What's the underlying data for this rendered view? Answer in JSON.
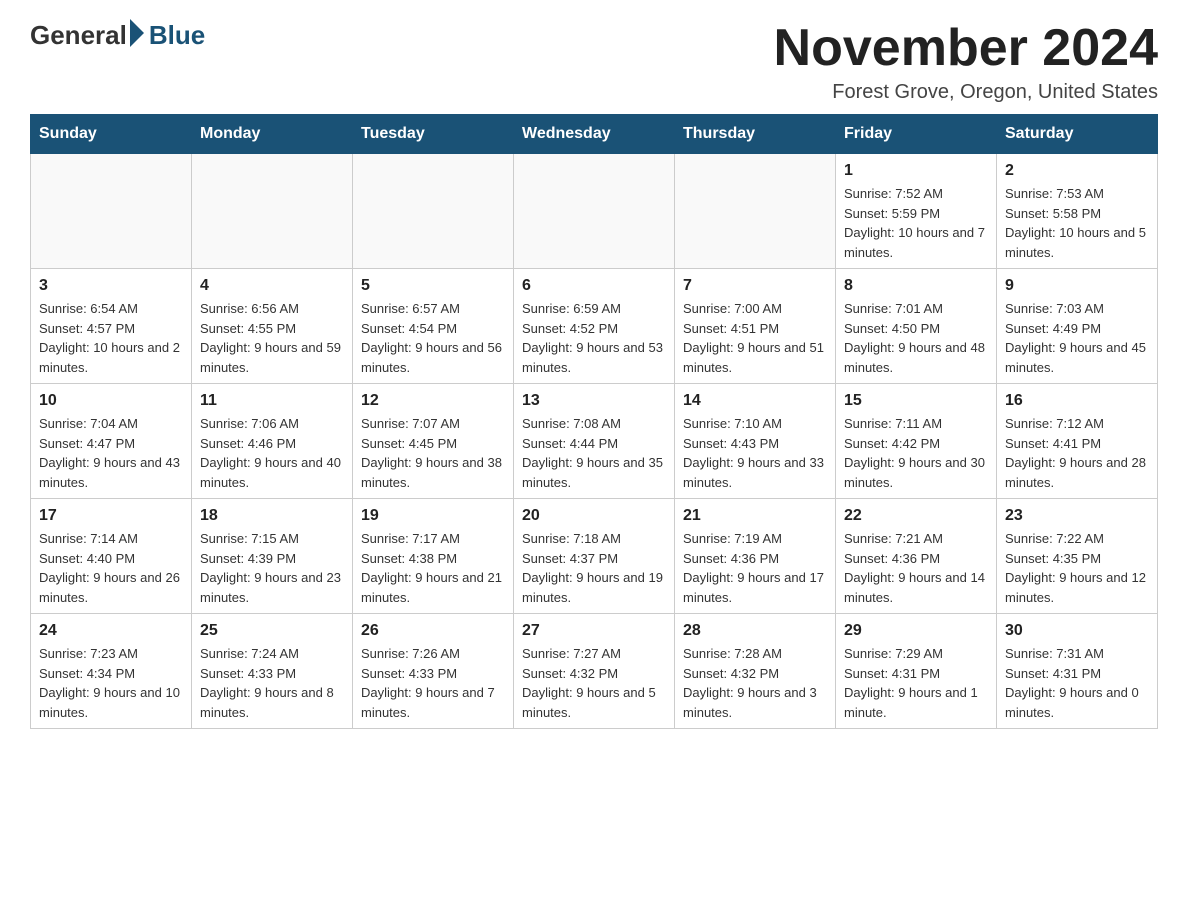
{
  "logo": {
    "general": "General",
    "blue": "Blue"
  },
  "title": "November 2024",
  "location": "Forest Grove, Oregon, United States",
  "days_of_week": [
    "Sunday",
    "Monday",
    "Tuesday",
    "Wednesday",
    "Thursday",
    "Friday",
    "Saturday"
  ],
  "weeks": [
    [
      {
        "day": "",
        "info": ""
      },
      {
        "day": "",
        "info": ""
      },
      {
        "day": "",
        "info": ""
      },
      {
        "day": "",
        "info": ""
      },
      {
        "day": "",
        "info": ""
      },
      {
        "day": "1",
        "info": "Sunrise: 7:52 AM\nSunset: 5:59 PM\nDaylight: 10 hours and 7 minutes."
      },
      {
        "day": "2",
        "info": "Sunrise: 7:53 AM\nSunset: 5:58 PM\nDaylight: 10 hours and 5 minutes."
      }
    ],
    [
      {
        "day": "3",
        "info": "Sunrise: 6:54 AM\nSunset: 4:57 PM\nDaylight: 10 hours and 2 minutes."
      },
      {
        "day": "4",
        "info": "Sunrise: 6:56 AM\nSunset: 4:55 PM\nDaylight: 9 hours and 59 minutes."
      },
      {
        "day": "5",
        "info": "Sunrise: 6:57 AM\nSunset: 4:54 PM\nDaylight: 9 hours and 56 minutes."
      },
      {
        "day": "6",
        "info": "Sunrise: 6:59 AM\nSunset: 4:52 PM\nDaylight: 9 hours and 53 minutes."
      },
      {
        "day": "7",
        "info": "Sunrise: 7:00 AM\nSunset: 4:51 PM\nDaylight: 9 hours and 51 minutes."
      },
      {
        "day": "8",
        "info": "Sunrise: 7:01 AM\nSunset: 4:50 PM\nDaylight: 9 hours and 48 minutes."
      },
      {
        "day": "9",
        "info": "Sunrise: 7:03 AM\nSunset: 4:49 PM\nDaylight: 9 hours and 45 minutes."
      }
    ],
    [
      {
        "day": "10",
        "info": "Sunrise: 7:04 AM\nSunset: 4:47 PM\nDaylight: 9 hours and 43 minutes."
      },
      {
        "day": "11",
        "info": "Sunrise: 7:06 AM\nSunset: 4:46 PM\nDaylight: 9 hours and 40 minutes."
      },
      {
        "day": "12",
        "info": "Sunrise: 7:07 AM\nSunset: 4:45 PM\nDaylight: 9 hours and 38 minutes."
      },
      {
        "day": "13",
        "info": "Sunrise: 7:08 AM\nSunset: 4:44 PM\nDaylight: 9 hours and 35 minutes."
      },
      {
        "day": "14",
        "info": "Sunrise: 7:10 AM\nSunset: 4:43 PM\nDaylight: 9 hours and 33 minutes."
      },
      {
        "day": "15",
        "info": "Sunrise: 7:11 AM\nSunset: 4:42 PM\nDaylight: 9 hours and 30 minutes."
      },
      {
        "day": "16",
        "info": "Sunrise: 7:12 AM\nSunset: 4:41 PM\nDaylight: 9 hours and 28 minutes."
      }
    ],
    [
      {
        "day": "17",
        "info": "Sunrise: 7:14 AM\nSunset: 4:40 PM\nDaylight: 9 hours and 26 minutes."
      },
      {
        "day": "18",
        "info": "Sunrise: 7:15 AM\nSunset: 4:39 PM\nDaylight: 9 hours and 23 minutes."
      },
      {
        "day": "19",
        "info": "Sunrise: 7:17 AM\nSunset: 4:38 PM\nDaylight: 9 hours and 21 minutes."
      },
      {
        "day": "20",
        "info": "Sunrise: 7:18 AM\nSunset: 4:37 PM\nDaylight: 9 hours and 19 minutes."
      },
      {
        "day": "21",
        "info": "Sunrise: 7:19 AM\nSunset: 4:36 PM\nDaylight: 9 hours and 17 minutes."
      },
      {
        "day": "22",
        "info": "Sunrise: 7:21 AM\nSunset: 4:36 PM\nDaylight: 9 hours and 14 minutes."
      },
      {
        "day": "23",
        "info": "Sunrise: 7:22 AM\nSunset: 4:35 PM\nDaylight: 9 hours and 12 minutes."
      }
    ],
    [
      {
        "day": "24",
        "info": "Sunrise: 7:23 AM\nSunset: 4:34 PM\nDaylight: 9 hours and 10 minutes."
      },
      {
        "day": "25",
        "info": "Sunrise: 7:24 AM\nSunset: 4:33 PM\nDaylight: 9 hours and 8 minutes."
      },
      {
        "day": "26",
        "info": "Sunrise: 7:26 AM\nSunset: 4:33 PM\nDaylight: 9 hours and 7 minutes."
      },
      {
        "day": "27",
        "info": "Sunrise: 7:27 AM\nSunset: 4:32 PM\nDaylight: 9 hours and 5 minutes."
      },
      {
        "day": "28",
        "info": "Sunrise: 7:28 AM\nSunset: 4:32 PM\nDaylight: 9 hours and 3 minutes."
      },
      {
        "day": "29",
        "info": "Sunrise: 7:29 AM\nSunset: 4:31 PM\nDaylight: 9 hours and 1 minute."
      },
      {
        "day": "30",
        "info": "Sunrise: 7:31 AM\nSunset: 4:31 PM\nDaylight: 9 hours and 0 minutes."
      }
    ]
  ]
}
